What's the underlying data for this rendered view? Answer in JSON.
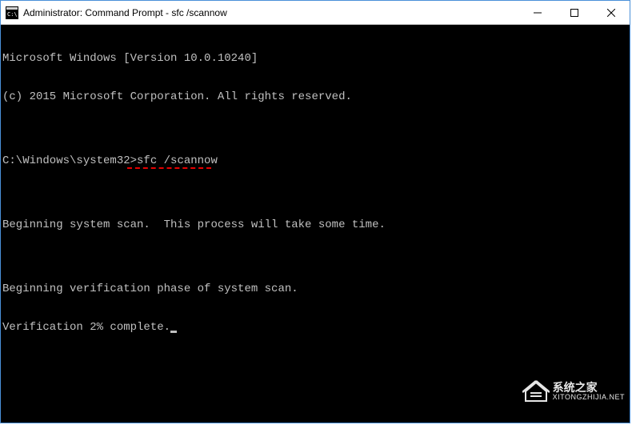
{
  "titlebar": {
    "title": "Administrator: Command Prompt - sfc  /scannow"
  },
  "terminal": {
    "line1": "Microsoft Windows [Version 10.0.10240]",
    "line2": "(c) 2015 Microsoft Corporation. All rights reserved.",
    "blank1": "",
    "prompt": "C:\\Windows\\system32>",
    "command": "sfc /scannow",
    "blank2": "",
    "line3": "Beginning system scan.  This process will take some time.",
    "blank3": "",
    "line4": "Beginning verification phase of system scan.",
    "line5": "Verification 2% complete."
  },
  "watermark": {
    "main": "系统之家",
    "sub": "XITONGZHIJIA.NET"
  }
}
